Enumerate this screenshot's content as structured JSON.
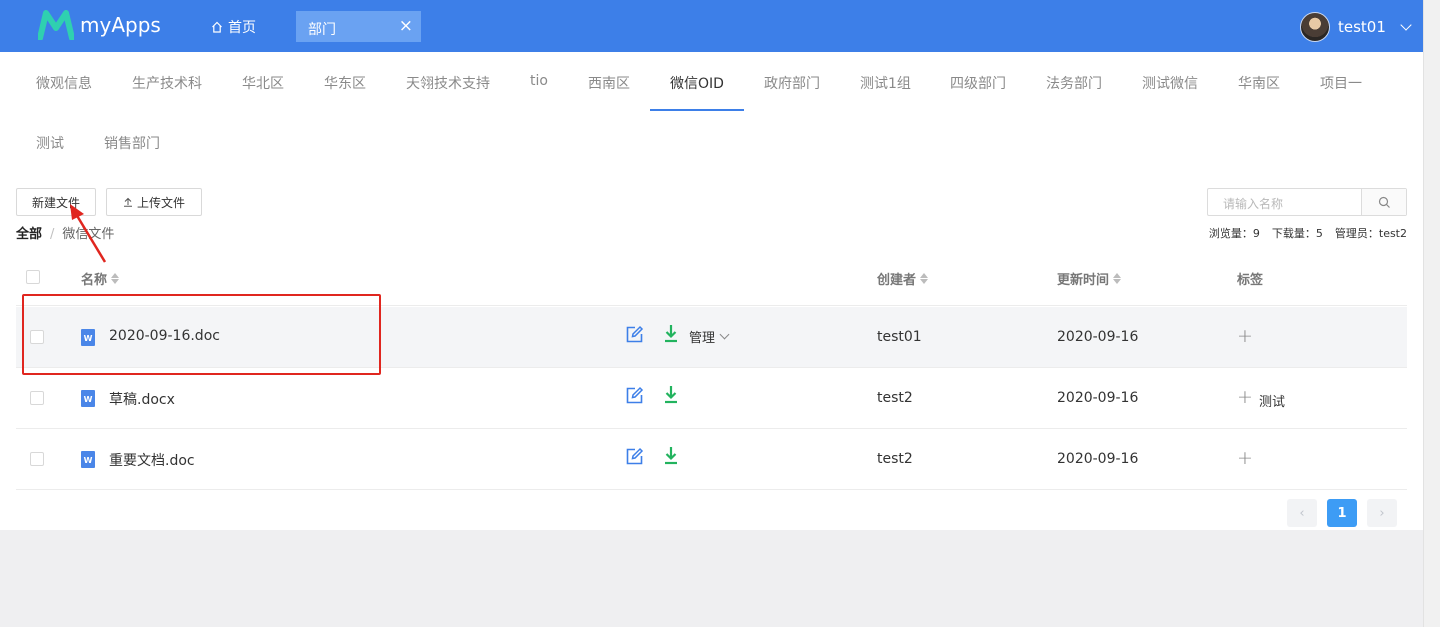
{
  "header": {
    "app_name": "myApps",
    "home_label": "首页",
    "open_tab_label": "部门",
    "close_symbol": "×",
    "user_name": "test01",
    "brand_color": "#3d7fe8"
  },
  "dept_tabs": {
    "row1": [
      "微观信息",
      "生产技术科",
      "华北区",
      "华东区",
      "天翎技术支持",
      "tio",
      "西南区",
      "微信OID",
      "政府部门",
      "测试1组",
      "四级部门",
      "法务部门",
      "测试微信",
      "华南区",
      "项目一"
    ],
    "row2": [
      "测试",
      "销售部门"
    ],
    "active": "微信OID"
  },
  "toolbar": {
    "new_file": "新建文件",
    "upload_file": "上传文件",
    "search_placeholder": "请输入名称"
  },
  "breadcrumb": {
    "root": "全部",
    "separator": "/",
    "current": "微信文件"
  },
  "stats": {
    "views": "浏览量：9",
    "downloads": "下载量：5",
    "admin": "管理员：test2"
  },
  "table": {
    "columns": {
      "name": "名称",
      "creator": "创建者",
      "updated": "更新时间",
      "tags": "标签"
    },
    "rows": [
      {
        "icon": "word-doc-icon",
        "name": "2020-09-16.doc",
        "manage": "管理",
        "creator": "test01",
        "updated": "2020-09-16",
        "tag": ""
      },
      {
        "icon": "word-doc-icon",
        "name": "草稿.docx",
        "manage": "",
        "creator": "test2",
        "updated": "2020-09-16",
        "tag": "测试"
      },
      {
        "icon": "word-doc-icon",
        "name": "重要文档.doc",
        "manage": "",
        "creator": "test2",
        "updated": "2020-09-16",
        "tag": ""
      }
    ]
  },
  "pagination": {
    "prev": "‹",
    "current_page": "1",
    "next": "›"
  },
  "icon_letter": "W",
  "plus_symbol": "+",
  "annotation_color": "#e0261f"
}
